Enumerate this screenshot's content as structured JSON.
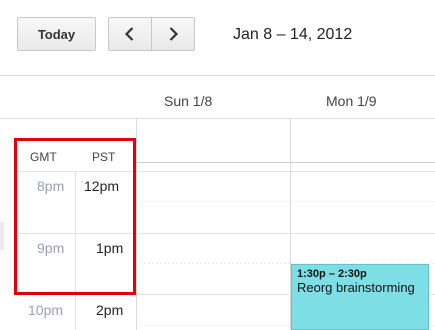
{
  "toolbar": {
    "today_label": "Today",
    "prev_icon": "chevron-left-icon",
    "next_icon": "chevron-right-icon",
    "date_range": "Jan 8 – 14, 2012"
  },
  "days": [
    {
      "label": "Sun 1/8"
    },
    {
      "label": "Mon 1/9"
    }
  ],
  "timezones": {
    "primary": "GMT",
    "secondary": "PST"
  },
  "hours": [
    {
      "gmt": "8pm",
      "pst": "12pm"
    },
    {
      "gmt": "9pm",
      "pst": "1pm"
    },
    {
      "gmt": "10pm",
      "pst": "2pm"
    }
  ],
  "event": {
    "time": "1:30p – 2:30p",
    "title": "Reorg brainstorming",
    "color": "#7ddfe5"
  },
  "colors": {
    "highlight_border": "#e1000f",
    "gmt_text": "#9aa0b0"
  }
}
